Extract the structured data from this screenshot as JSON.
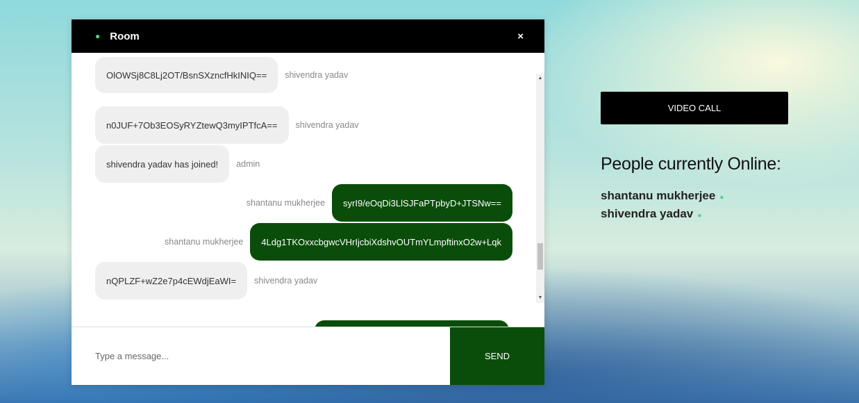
{
  "chat": {
    "room_name": "Room",
    "close_label": "×",
    "messages": [
      {
        "text": "OlOWSj8C8Lj2OT/BsnSXzncfHkINIQ==",
        "sender": "shivendra yadav"
      },
      {
        "text": "n0JUF+7Ob3EOSyRYZtewQ3myIPTfcA==",
        "sender": "shivendra yadav"
      },
      {
        "text": "shivendra yadav has joined!",
        "sender": "admin"
      },
      {
        "text": "syrI9/eOqDi3LlSJFaPTpbyD+JTSNw==",
        "sender": "shantanu mukherjee"
      },
      {
        "text": "4Ldg1TKOxxcbgwcVHrIjcbiXdshvOUTmYLmpftinxO2w+Lqk",
        "sender": "shantanu mukherjee"
      },
      {
        "text": "nQPLZF+wZ2e7p4cEWdjEaWI=",
        "sender": "shivendra yadav"
      }
    ],
    "input_placeholder": "Type a message...",
    "send_label": "SEND"
  },
  "sidebar": {
    "video_call_label": "VIDEO CALL",
    "people_title": "People currently Online:",
    "people": [
      "shantanu mukherjee",
      "shivendra yadav"
    ]
  },
  "colors": {
    "accent_green": "#0a4d0a",
    "online_dot": "#4fd27a",
    "header_black": "#000000"
  }
}
